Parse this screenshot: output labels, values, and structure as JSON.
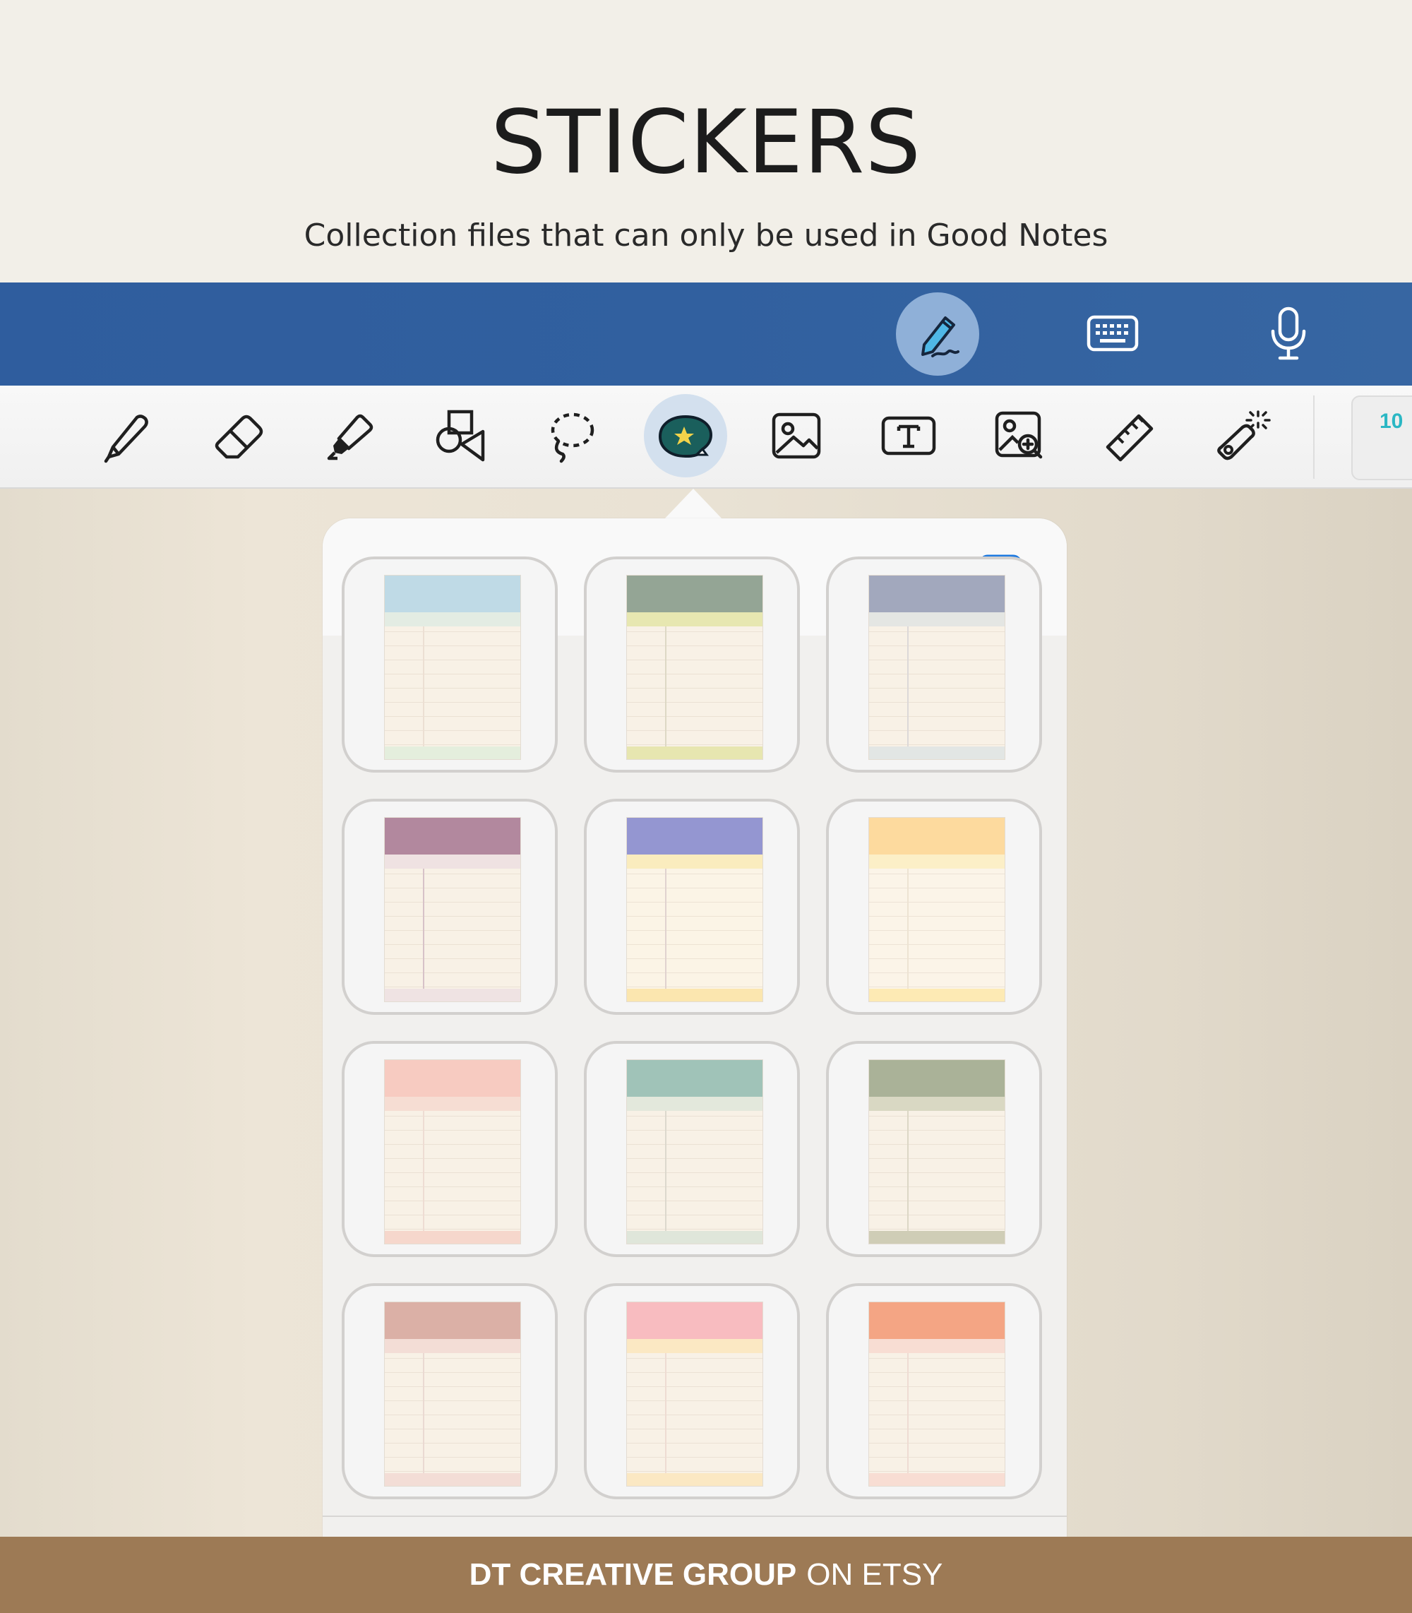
{
  "header": {
    "title": "STICKERS",
    "subtitle": "Collection files that can only be used in Good Notes"
  },
  "topbar": {
    "buttons": [
      {
        "icon": "pen-write-icon",
        "active": true
      },
      {
        "icon": "keyboard-icon",
        "active": false
      },
      {
        "icon": "microphone-icon",
        "active": false
      }
    ]
  },
  "toolbar": {
    "tools": [
      {
        "icon": "pen-icon"
      },
      {
        "icon": "eraser-icon"
      },
      {
        "icon": "highlighter-icon"
      },
      {
        "icon": "shapes-icon"
      },
      {
        "icon": "lasso-icon"
      },
      {
        "icon": "sticker-icon",
        "active": true
      },
      {
        "icon": "image-icon"
      },
      {
        "icon": "text-box-icon"
      },
      {
        "icon": "image-search-icon"
      },
      {
        "icon": "ruler-icon"
      },
      {
        "icon": "laser-pointer-icon"
      }
    ],
    "calendar_badge": "10"
  },
  "sticker_panel": {
    "toggle_icon": "split-view-icon",
    "stickers": [
      {
        "header": "#bfdae6",
        "band": "#e3ece3",
        "footer": "#e4eedd",
        "body": "#f8f1e6",
        "margin": "#ecdfd3"
      },
      {
        "header": "#94a595",
        "band": "#e7e7b1",
        "footer": "#e7e6b0",
        "body": "#f8f1e6",
        "margin": "#ddd8c5"
      },
      {
        "header": "#a2a8bd",
        "band": "#e4e6e3",
        "footer": "#e2e6e4",
        "body": "#f8f1e6",
        "margin": "#dcd8d8"
      },
      {
        "header": "#b2889e",
        "band": "#efe2e2",
        "footer": "#efe3e3",
        "body": "#f8f1e6",
        "margin": "#d7c2c8"
      },
      {
        "header": "#9496d1",
        "band": "#faecbe",
        "footer": "#fbe6af",
        "body": "#fbf4e6",
        "margin": "#e0d2cf"
      },
      {
        "header": "#fdda9e",
        "band": "#fcefc7",
        "footer": "#fdeab4",
        "body": "#fbf4e8",
        "margin": "#ede3d3"
      },
      {
        "header": "#f7cbc1",
        "band": "#f6ddd3",
        "footer": "#f6d7cc",
        "body": "#f8f1e6",
        "margin": "#eedcd3"
      },
      {
        "header": "#a0c3b8",
        "band": "#e3e8dc",
        "footer": "#dfe6da",
        "body": "#f8f1e6",
        "margin": "#dcd8cd"
      },
      {
        "header": "#aab298",
        "band": "#d9d8c3",
        "footer": "#cfcdb6",
        "body": "#f8f1e6",
        "margin": "#dcd7c6"
      },
      {
        "header": "#dbb0a6",
        "band": "#f3ddd6",
        "footer": "#f3ddd6",
        "body": "#f8f1e6",
        "margin": "#ead9d2"
      },
      {
        "header": "#f8bcc0",
        "band": "#fbe8c3",
        "footer": "#fbe8c3",
        "body": "#f8f1e6",
        "margin": "#eedcd3"
      },
      {
        "header": "#f4a584",
        "band": "#f8ddd3",
        "footer": "#f8ddd3",
        "body": "#f8f1e6",
        "margin": "#eedcd3"
      }
    ]
  },
  "footer": {
    "brand": "DT CREATIVE GROUP",
    "suffix": "ON ETSY"
  }
}
